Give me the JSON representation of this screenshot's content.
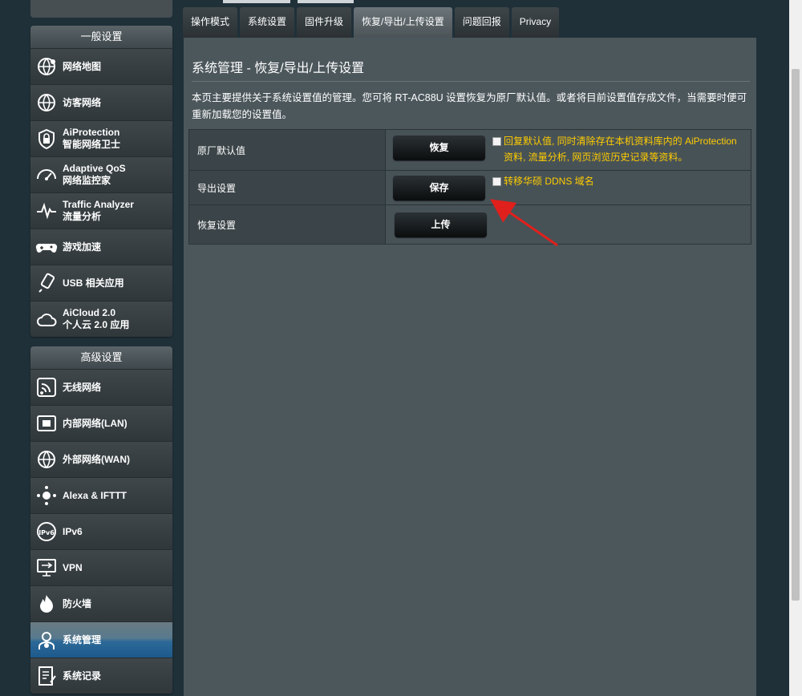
{
  "sidebar": {
    "general_header": "一般设置",
    "general_items": [
      {
        "l1": "网络地图",
        "l2": "",
        "icon": "globe-network-icon"
      },
      {
        "l1": "访客网络",
        "l2": "",
        "icon": "guest-globe-icon"
      },
      {
        "l1": "AiProtection",
        "l2": "智能网络卫士",
        "icon": "shield-lock-icon"
      },
      {
        "l1": "Adaptive QoS",
        "l2": "网络监控家",
        "icon": "speedometer-icon"
      },
      {
        "l1": "Traffic Analyzer",
        "l2": "流量分析",
        "icon": "pulse-icon"
      },
      {
        "l1": "游戏加速",
        "l2": "",
        "icon": "gamepad-icon"
      },
      {
        "l1": "USB 相关应用",
        "l2": "",
        "icon": "usb-icon"
      },
      {
        "l1": "AiCloud 2.0",
        "l2": "个人云 2.0 应用",
        "icon": "cloud-icon"
      }
    ],
    "advanced_header": "高级设置",
    "advanced_items": [
      {
        "l1": "无线网络",
        "l2": "",
        "icon": "wifi-icon"
      },
      {
        "l1": "内部网络(LAN)",
        "l2": "",
        "icon": "lan-icon"
      },
      {
        "l1": "外部网络(WAN)",
        "l2": "",
        "icon": "wan-globe-icon"
      },
      {
        "l1": "Alexa & IFTTT",
        "l2": "",
        "icon": "alexa-icon"
      },
      {
        "l1": "IPv6",
        "l2": "",
        "icon": "ipv6-icon"
      },
      {
        "l1": "VPN",
        "l2": "",
        "icon": "vpn-monitor-icon"
      },
      {
        "l1": "防火墙",
        "l2": "",
        "icon": "firewall-flame-icon"
      },
      {
        "l1": "系统管理",
        "l2": "",
        "icon": "admin-gear-icon",
        "active": true
      },
      {
        "l1": "系统记录",
        "l2": "",
        "icon": "log-notepad-icon"
      }
    ]
  },
  "tabs": [
    "操作模式",
    "系统设置",
    "固件升级",
    "恢复/导出/上传设置",
    "问题回报",
    "Privacy"
  ],
  "active_tab_index": 3,
  "panel": {
    "title": "系统管理 - 恢复/导出/上传设置",
    "description": "本页主要提供关于系统设置值的管理。您可将 RT-AC88U 设置恢复为原厂默认值。或者将目前设置值存成文件，当需要时便可重新加载您的设置值。"
  },
  "rows": [
    {
      "label": "原厂默认值",
      "button": "恢复",
      "checkbox": true,
      "note": "回复默认值, 同时清除存在本机资料库内的 AiProtection 资料, 流量分析, 网页浏览历史记录等资料。"
    },
    {
      "label": "导出设置",
      "button": "保存",
      "checkbox": true,
      "note": "转移华硕 DDNS 域名"
    },
    {
      "label": "恢复设置",
      "button": "上传",
      "checkbox": false,
      "note": ""
    }
  ],
  "colors": {
    "accent_note": "#ffcc00",
    "annotation_arrow": "#e0201c",
    "active_item": "#1d5a8c"
  }
}
